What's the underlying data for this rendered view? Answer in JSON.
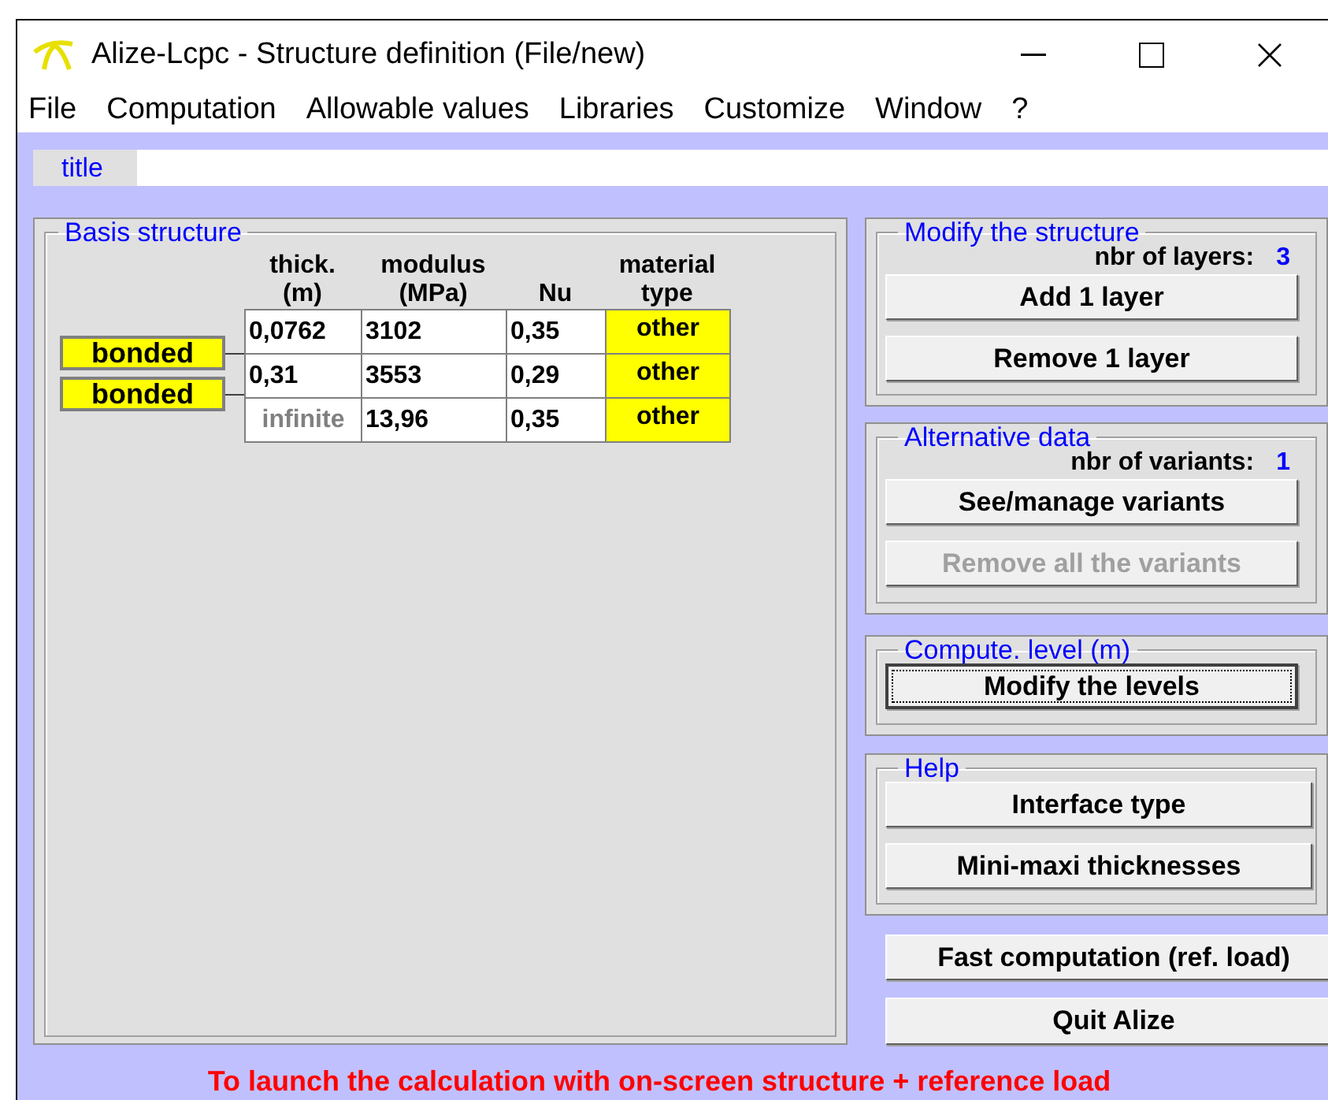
{
  "window": {
    "title": "Alize-Lcpc - Structure definition (File/new)"
  },
  "menu": [
    "File",
    "Computation",
    "Allowable values",
    "Libraries",
    "Customize",
    "Window",
    "?"
  ],
  "title_field": {
    "label": "title"
  },
  "basis_structure": {
    "title": "Basis structure",
    "headers": [
      "thick.\n(m)",
      "modulus\n(MPa)",
      "Nu",
      "material\ntype"
    ],
    "interfaces": [
      "bonded",
      "bonded"
    ],
    "layers": [
      {
        "thickness": {
          "text": "0,0762",
          "disabled": false
        },
        "modulus": "3102",
        "nu": "0,35",
        "material": "other"
      },
      {
        "thickness": {
          "text": "0,31",
          "disabled": false
        },
        "modulus": "3553",
        "nu": "0,29",
        "material": "other"
      },
      {
        "thickness": {
          "text": "infinite",
          "disabled": true
        },
        "modulus": "13,96",
        "nu": "0,35",
        "material": "other"
      }
    ]
  },
  "groups": [
    {
      "title": "Modify the structure",
      "count_label": "nbr of layers:",
      "count": "3",
      "buttons": [
        {
          "label": "Add 1 layer",
          "disabled": false,
          "focused": false
        },
        {
          "label": "Remove 1 layer",
          "disabled": false,
          "focused": false
        }
      ]
    },
    {
      "title": "Alternative data",
      "count_label": "nbr of variants:",
      "count": "1",
      "buttons": [
        {
          "label": "See/manage variants",
          "disabled": false,
          "focused": false
        },
        {
          "label": "Remove all the variants",
          "disabled": true,
          "focused": false
        }
      ]
    },
    {
      "title": "Compute. level (m)",
      "buttons": [
        {
          "label": "Modify the levels",
          "disabled": false,
          "focused": true
        }
      ]
    },
    {
      "title": "Help",
      "buttons": [
        {
          "label": "Interface type",
          "disabled": false,
          "focused": false
        },
        {
          "label": "Mini-maxi thicknesses",
          "disabled": false,
          "focused": false
        }
      ]
    }
  ],
  "actions": [
    {
      "label": "Fast computation (ref. load)",
      "disabled": false,
      "focused": false
    },
    {
      "label": "Quit Alize",
      "disabled": false,
      "focused": false
    }
  ],
  "message": "To launch the calculation with on-screen structure + reference load"
}
